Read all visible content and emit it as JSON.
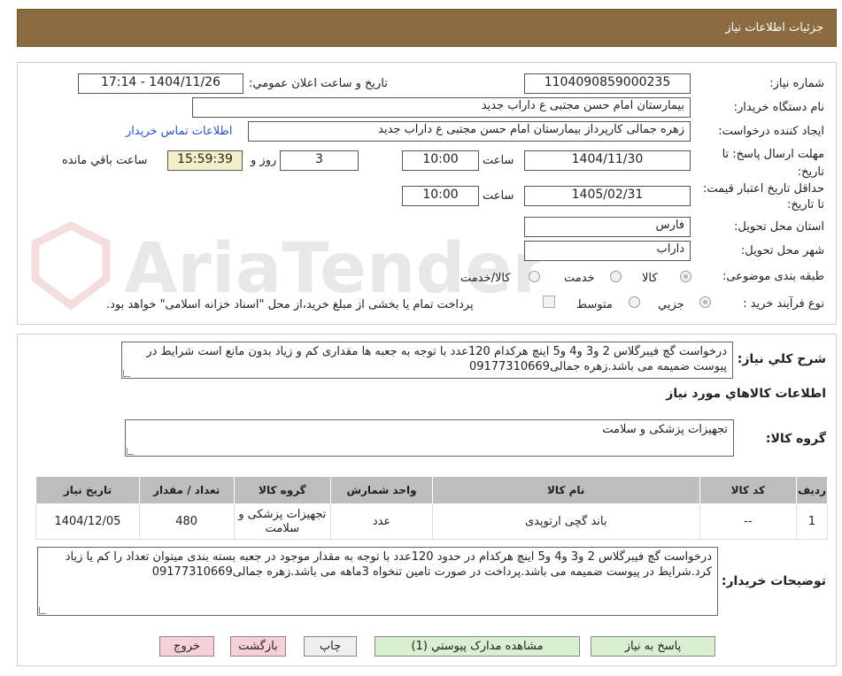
{
  "header": {
    "title": "جزئیات اطلاعات نیاز"
  },
  "watermark": {
    "text": "AriaTender.neT"
  },
  "form": {
    "need_number_label": "شماره نیاز:",
    "need_number": "1104090859000235",
    "announce_label": "تاریخ و ساعت اعلان عمومي:",
    "announce_value": "1404/11/26 - 17:14",
    "buyer_org_label": "نام دستگاه خريدار:",
    "buyer_org": "بیمارستان امام حسن مجتبی  ع  داراب جدید",
    "creator_label": "ايجاد كننده درخواست:",
    "creator": "زهره جمالی کارپرداز بیمارستان امام حسن مجتبی  ع  داراب جدید",
    "contact_link": "اطلاعات تماس خريدار",
    "deadline_label": "مهلت ارسال پاسخ: تا تاریخ:",
    "deadline_date": "1404/11/30",
    "time_word": "ساعت",
    "deadline_time": "10:00",
    "days_value": "3",
    "days_word": "روز و",
    "remaining_time": "15:59:39",
    "remaining_word": "ساعت باقي مانده",
    "validity_label": "حداقل تاریخ اعتبار قیمت: تا تاریخ:",
    "validity_date": "1405/02/31",
    "validity_time": "10:00",
    "province_label": "استان محل تحويل:",
    "province": "فارس",
    "city_label": "شهر محل تحويل:",
    "city": "داراب",
    "category_label": "طبقه بندی موضوعی:",
    "category_options": [
      "کالا",
      "خدمت",
      "کالا/خدمت"
    ],
    "purchase_type_label": "نوع فرآيند خريد :",
    "purchase_options": [
      "جزيي",
      "متوسط"
    ],
    "purchase_note": "پرداخت تمام یا بخشی از مبلغ خرید،از محل \"اسناد خزانه اسلامی\" خواهد بود."
  },
  "summary": {
    "label": "شرح کلي نياز:",
    "text": "درخواست گچ فیبرگلاس 2 و3 و4 و5 اینچ هرکدام 120عدد با توجه به جعبه ها مقداری کم و زیاد بدون مانع است شرایط در پیوست ضمیمه می باشد.زهره جمالی09177310669"
  },
  "goods_section": {
    "title": "اطلاعات کالاهاي مورد نياز",
    "group_label": "گروه کالا:",
    "group_value": "تجهیزات پزشکی و سلامت"
  },
  "table": {
    "headers": [
      "رديف",
      "کد کالا",
      "نام کالا",
      "واحد شمارش",
      "گروه کالا",
      "تعداد / مقدار",
      "تاريخ نياز"
    ],
    "rows": [
      [
        "1",
        "--",
        "باند گچی ارتوپدی",
        "عدد",
        "تجهیزات پزشکی و سلامت",
        "480",
        "1404/12/05"
      ]
    ]
  },
  "buyer_notes": {
    "label": "توضيحات خريدار:",
    "text": "درخواست گچ فیبرگلاس 2 و3 و4 و5 اینچ هرکدام در حدود 120عدد با توجه به مقدار موجود در جعبه بسته بندی میتوان تعداد را کم یا زیاد کرد.شرایط در پیوست ضمیمه می باشد.پرداخت در صورت تامین تنخواه 3ماهه می باشد.زهره جمالی09177310669"
  },
  "buttons": {
    "reply": "پاسخ به نیاز",
    "attachments": "مشاهده مدارک پیوستي (1)",
    "print": "چاپ",
    "back": "بازگشت",
    "exit": "خروج"
  }
}
